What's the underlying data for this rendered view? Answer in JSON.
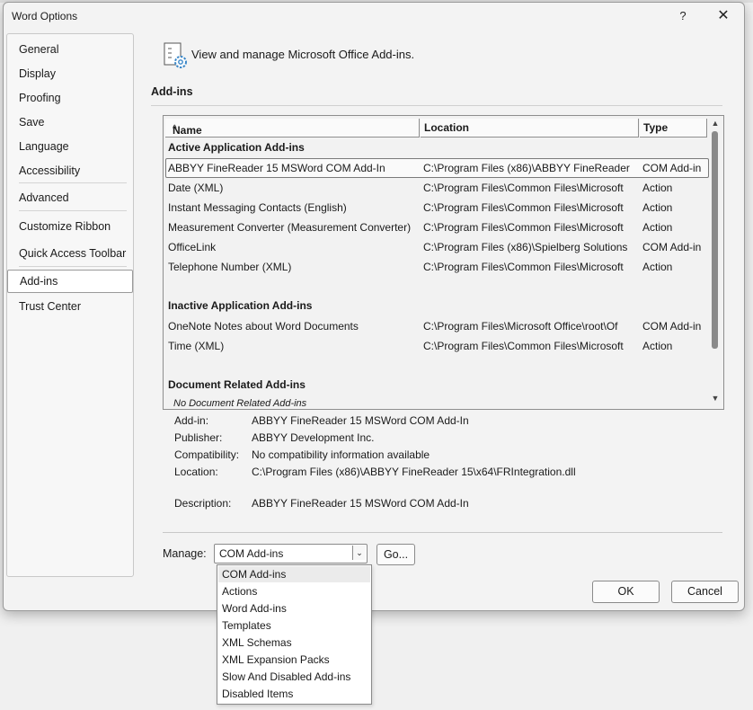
{
  "window": {
    "title": "Word Options",
    "help_label": "?",
    "close_label": "✕"
  },
  "nav": {
    "items": [
      "General",
      "Display",
      "Proofing",
      "Save",
      "Language",
      "Accessibility",
      "Advanced",
      "Customize Ribbon",
      "Quick Access Toolbar",
      "Add-ins",
      "Trust Center"
    ],
    "selected": "Add-ins"
  },
  "header": {
    "icon": "addins-gear-icon",
    "text": "View and manage Microsoft Office Add-ins."
  },
  "section": {
    "title": "Add-ins"
  },
  "table": {
    "columns": [
      "Name",
      "Location",
      "Type"
    ],
    "sort_indicator": "^",
    "groups": [
      {
        "title": "Active Application Add-ins",
        "rows": [
          {
            "name": "ABBYY FineReader 15 MSWord COM Add-In",
            "location": "C:\\Program Files (x86)\\ABBYY FineReader",
            "type": "COM Add-in"
          },
          {
            "name": "Date (XML)",
            "location": "C:\\Program Files\\Common Files\\Microsoft",
            "type": "Action"
          },
          {
            "name": "Instant Messaging Contacts (English)",
            "location": "C:\\Program Files\\Common Files\\Microsoft",
            "type": "Action"
          },
          {
            "name": "Measurement Converter (Measurement Converter)",
            "location": "C:\\Program Files\\Common Files\\Microsoft",
            "type": "Action"
          },
          {
            "name": "OfficeLink",
            "location": "C:\\Program Files (x86)\\Spielberg Solutions",
            "type": "COM Add-in"
          },
          {
            "name": "Telephone Number (XML)",
            "location": "C:\\Program Files\\Common Files\\Microsoft",
            "type": "Action"
          }
        ]
      },
      {
        "title": "Inactive Application Add-ins",
        "rows": [
          {
            "name": "OneNote Notes about Word Documents",
            "location": "C:\\Program Files\\Microsoft Office\\root\\Of",
            "type": "COM Add-in"
          },
          {
            "name": "Time (XML)",
            "location": "C:\\Program Files\\Common Files\\Microsoft",
            "type": "Action"
          }
        ]
      },
      {
        "title": "Document Related Add-ins",
        "empty_text": "No Document Related Add-ins",
        "rows": []
      }
    ],
    "selected_row": "ABBYY FineReader 15 MSWord COM Add-In"
  },
  "details": {
    "addin_label": "Add-in:",
    "addin": "ABBYY FineReader 15 MSWord COM Add-In",
    "publisher_label": "Publisher:",
    "publisher": "ABBYY Development Inc.",
    "compat_label": "Compatibility:",
    "compat": "No compatibility information available",
    "location_label": "Location:",
    "location": "C:\\Program Files (x86)\\ABBYY FineReader 15\\x64\\FRIntegration.dll",
    "desc_label": "Description:",
    "desc": "ABBYY FineReader 15 MSWord COM Add-In"
  },
  "manage": {
    "label": "Manage:",
    "value": "COM Add-ins",
    "go_label": "Go...",
    "options": [
      "COM Add-ins",
      "Actions",
      "Word Add-ins",
      "Templates",
      "XML Schemas",
      "XML Expansion Packs",
      "Slow And Disabled Add-ins",
      "Disabled Items"
    ]
  },
  "buttons": {
    "ok": "OK",
    "cancel": "Cancel"
  },
  "colors": {
    "window_bg": "#f3f3f3",
    "selection_border": "#7a7a7a",
    "gear_accent": "#3a87c8"
  }
}
